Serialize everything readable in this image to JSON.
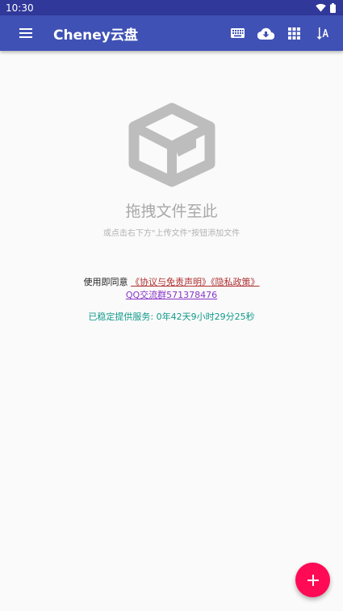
{
  "status_bar": {
    "time": "10:30",
    "icons": [
      "wifi-icon",
      "battery-icon"
    ]
  },
  "app_bar": {
    "title": "Cheney云盘",
    "icons": [
      "menu-icon",
      "keyboard-icon",
      "cloud-download-icon",
      "grid-view-icon",
      "sort-icon"
    ]
  },
  "empty_state": {
    "icon": "package-box-icon",
    "title": "拖拽文件至此",
    "subtitle": "或点击右下方\"上传文件\"按钮添加文件"
  },
  "agreement": {
    "prefix": "使用即同意",
    "link_terms": "《协议与免责声明》",
    "link_privacy": "《隐私政策》",
    "link_qq": "QQ交流群571378476"
  },
  "uptime": {
    "text": "已稳定提供服务: 0年42天9小时29分25秒"
  },
  "fab": {
    "icon": "plus-icon"
  },
  "colors": {
    "primary": "#3f51b5",
    "primary_dark": "#30389a",
    "accent": "#ff0a55",
    "uptime_text": "#119a8a",
    "link_red": "#b03030",
    "link_purple": "#8a35c9"
  }
}
